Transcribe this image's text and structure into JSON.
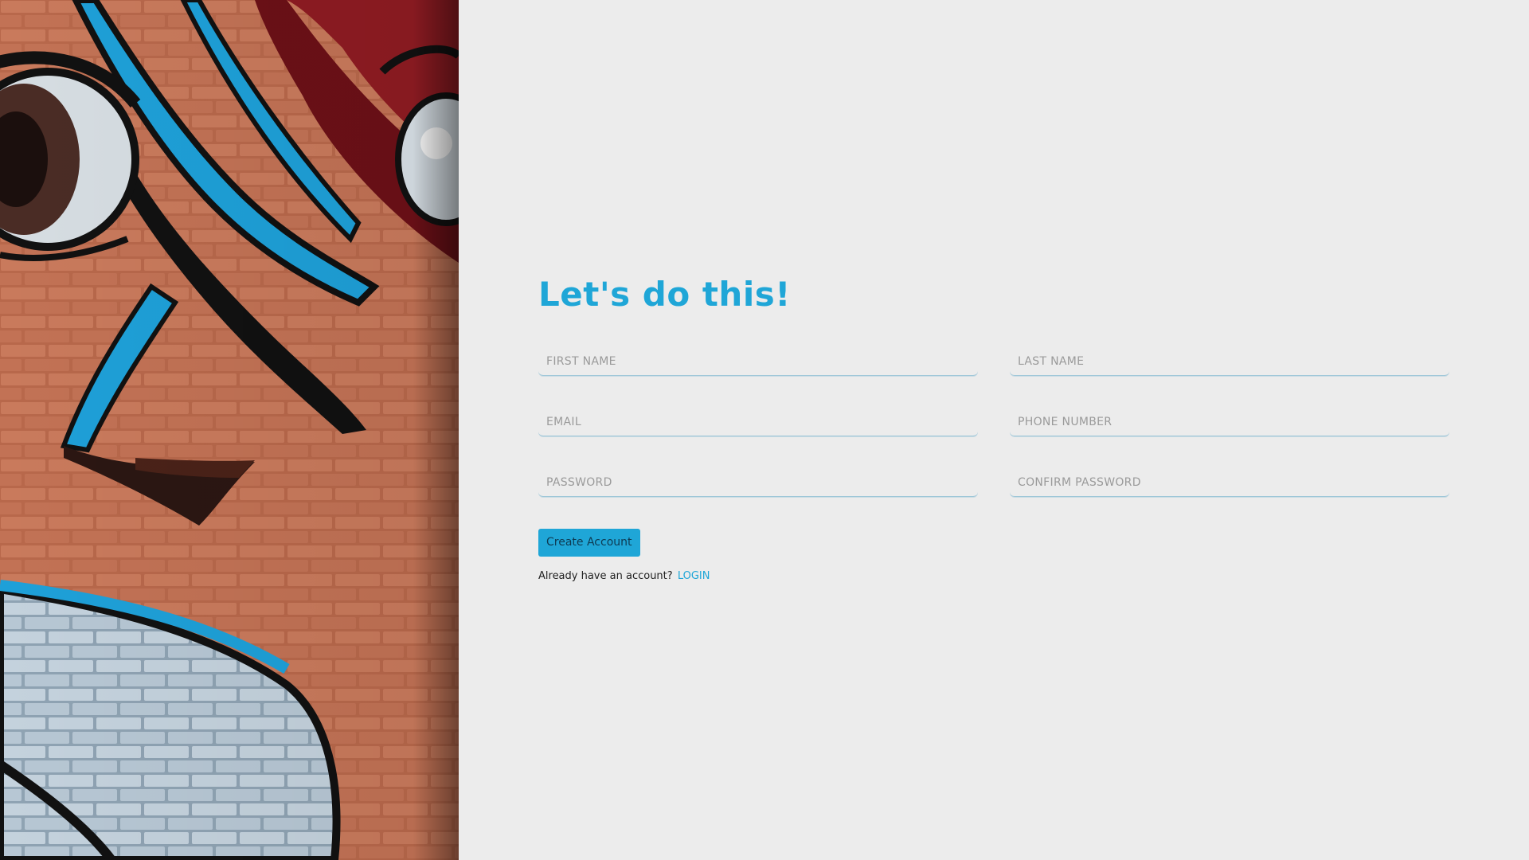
{
  "art": {
    "icon": "graffiti-brick-wall-artwork"
  },
  "form": {
    "heading": "Let's do this!",
    "fields": {
      "first_name": {
        "placeholder": "FIRST NAME",
        "value": ""
      },
      "last_name": {
        "placeholder": "LAST NAME",
        "value": ""
      },
      "email": {
        "placeholder": "EMAIL",
        "value": ""
      },
      "phone": {
        "placeholder": "PHONE NUMBER",
        "value": ""
      },
      "password": {
        "placeholder": "PASSWORD",
        "value": ""
      },
      "confirm_password": {
        "placeholder": "CONFIRM PASSWORD",
        "value": ""
      }
    },
    "submit_label": "Create Account",
    "login_prompt": "Already have an account?",
    "login_link": "LOGIN"
  },
  "colors": {
    "accent": "#1fa6d7",
    "background": "#ececec",
    "button_text": "#0e3a52"
  }
}
